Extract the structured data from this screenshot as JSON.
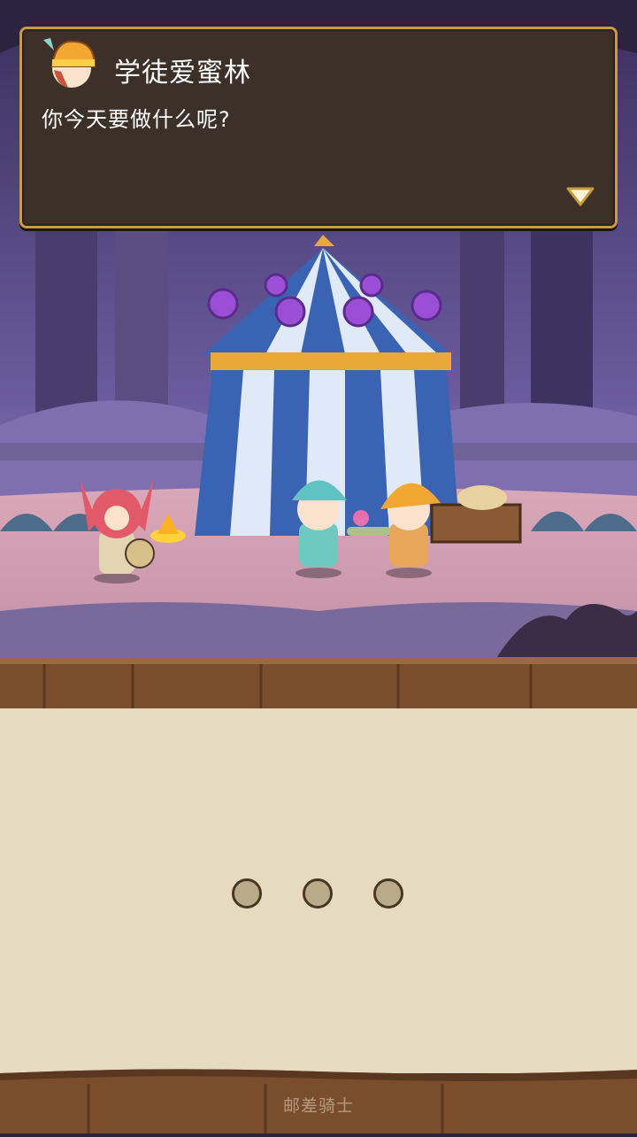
{
  "dialog": {
    "speaker": "学徒爱蜜林",
    "line": "你今天要做什么呢?",
    "next_icon": "triangle-down-icon",
    "portrait_icon": "apprentice-portrait-icon"
  },
  "loading": {
    "dots": 3
  },
  "footer": {
    "text": "邮差骑士"
  },
  "colors": {
    "dialog_bg": "#3d3028",
    "dialog_border": "#c99a3e",
    "parchment": "#e6dbc0",
    "wood": "#7a4e2d"
  }
}
